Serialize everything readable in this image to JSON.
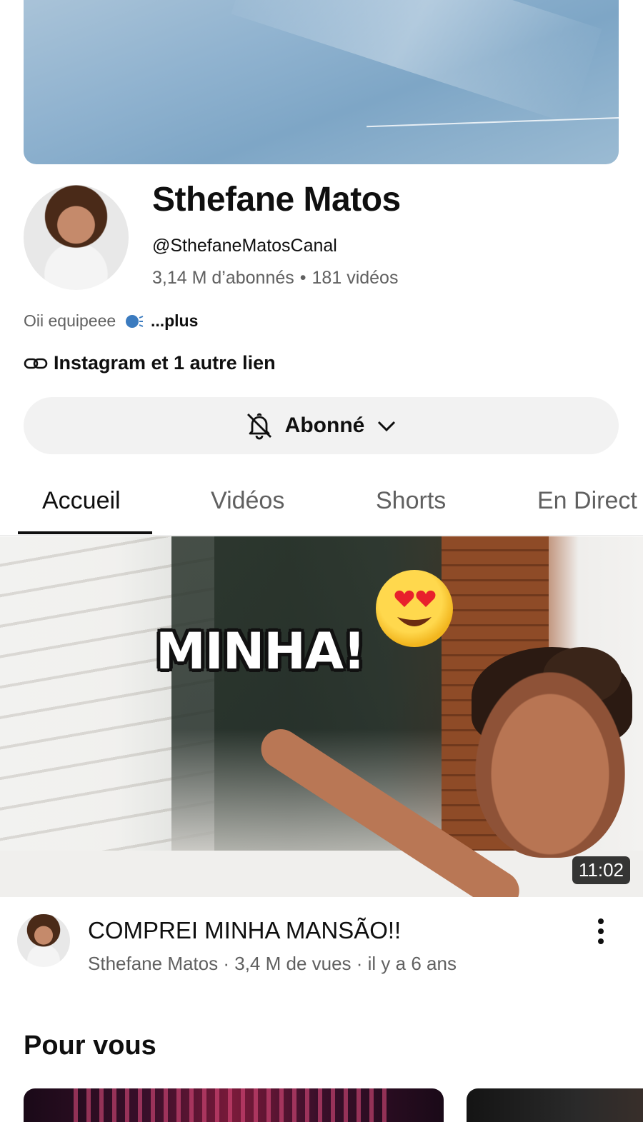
{
  "channel": {
    "name": "Sthefane Matos",
    "handle": "@SthefaneMatosCanal",
    "subscribers": "3,14 M d’abonnés",
    "separator": "•",
    "video_count": "181 vidéos",
    "description": "Oii equipeee",
    "description_more": "...plus",
    "links_text": "Instagram et 1 autre lien"
  },
  "subscribe_button": {
    "label": "Abonné",
    "icon_bell": "bell-off-icon",
    "icon_chevron": "chevron-down-icon"
  },
  "tabs": [
    {
      "label": "Accueil",
      "active": true
    },
    {
      "label": "Vidéos",
      "active": false
    },
    {
      "label": "Shorts",
      "active": false
    },
    {
      "label": "En Direct",
      "active": false
    }
  ],
  "featured_video": {
    "thumbnail_text": "MINHA!",
    "duration": "11:02",
    "title": "COMPREI MINHA MANSÃO!!",
    "channel": "Sthefane Matos",
    "views": "3,4 M de vues",
    "age": "il y a 6 ans",
    "meta_separator": " · "
  },
  "sections": {
    "for_you_title": "Pour vous"
  },
  "colors": {
    "text_primary": "#0f0f0f",
    "text_secondary": "#606060",
    "button_bg": "#f2f2f2"
  }
}
